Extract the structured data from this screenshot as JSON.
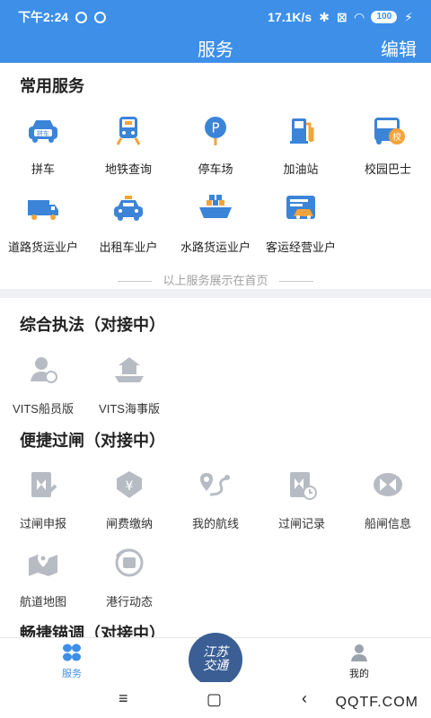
{
  "status_bar": {
    "time": "下午2:24",
    "speed": "17.1K/s",
    "battery": "100"
  },
  "header": {
    "title": "服务",
    "edit": "编辑"
  },
  "common": {
    "title": "常用服务",
    "items": [
      {
        "label": "拼车",
        "icon": "carpool-icon"
      },
      {
        "label": "地铁查询",
        "icon": "metro-icon"
      },
      {
        "label": "停车场",
        "icon": "parking-icon"
      },
      {
        "label": "加油站",
        "icon": "gas-station-icon"
      },
      {
        "label": "校园巴士",
        "icon": "school-bus-icon"
      },
      {
        "label": "道路货运业户",
        "icon": "truck-icon"
      },
      {
        "label": "出租车业户",
        "icon": "taxi-icon"
      },
      {
        "label": "水路货运业户",
        "icon": "ship-icon"
      },
      {
        "label": "客运经营业户",
        "icon": "passenger-transport-icon"
      }
    ],
    "note": "以上服务展示在首页"
  },
  "law": {
    "title": "综合执法（对接中）",
    "items": [
      {
        "label": "VITS船员版",
        "icon": "crew-icon"
      },
      {
        "label": "VITS海事版",
        "icon": "maritime-icon"
      }
    ]
  },
  "lock": {
    "title": "便捷过闸（对接中）",
    "items": [
      {
        "label": "过闸申报",
        "icon": "lock-apply-icon"
      },
      {
        "label": "闸费缴纳",
        "icon": "fee-payment-icon"
      },
      {
        "label": "我的航线",
        "icon": "route-icon"
      },
      {
        "label": "过闸记录",
        "icon": "lock-record-icon"
      },
      {
        "label": "船闸信息",
        "icon": "lock-info-icon"
      },
      {
        "label": "航道地图",
        "icon": "waterway-map-icon"
      },
      {
        "label": "港行动态",
        "icon": "port-news-icon"
      }
    ]
  },
  "anchor": {
    "title": "畅捷锚调（对接中）"
  },
  "bottom_nav": {
    "service": "服务",
    "logo_top": "江苏",
    "logo_bottom": "交通",
    "mine": "我的"
  },
  "watermark": "QQTF.COM",
  "colors": {
    "accent": "#3d8fe8",
    "icon_blue": "#3b84d8",
    "icon_orange": "#f3a33a",
    "icon_gray": "#b7bcc4"
  }
}
